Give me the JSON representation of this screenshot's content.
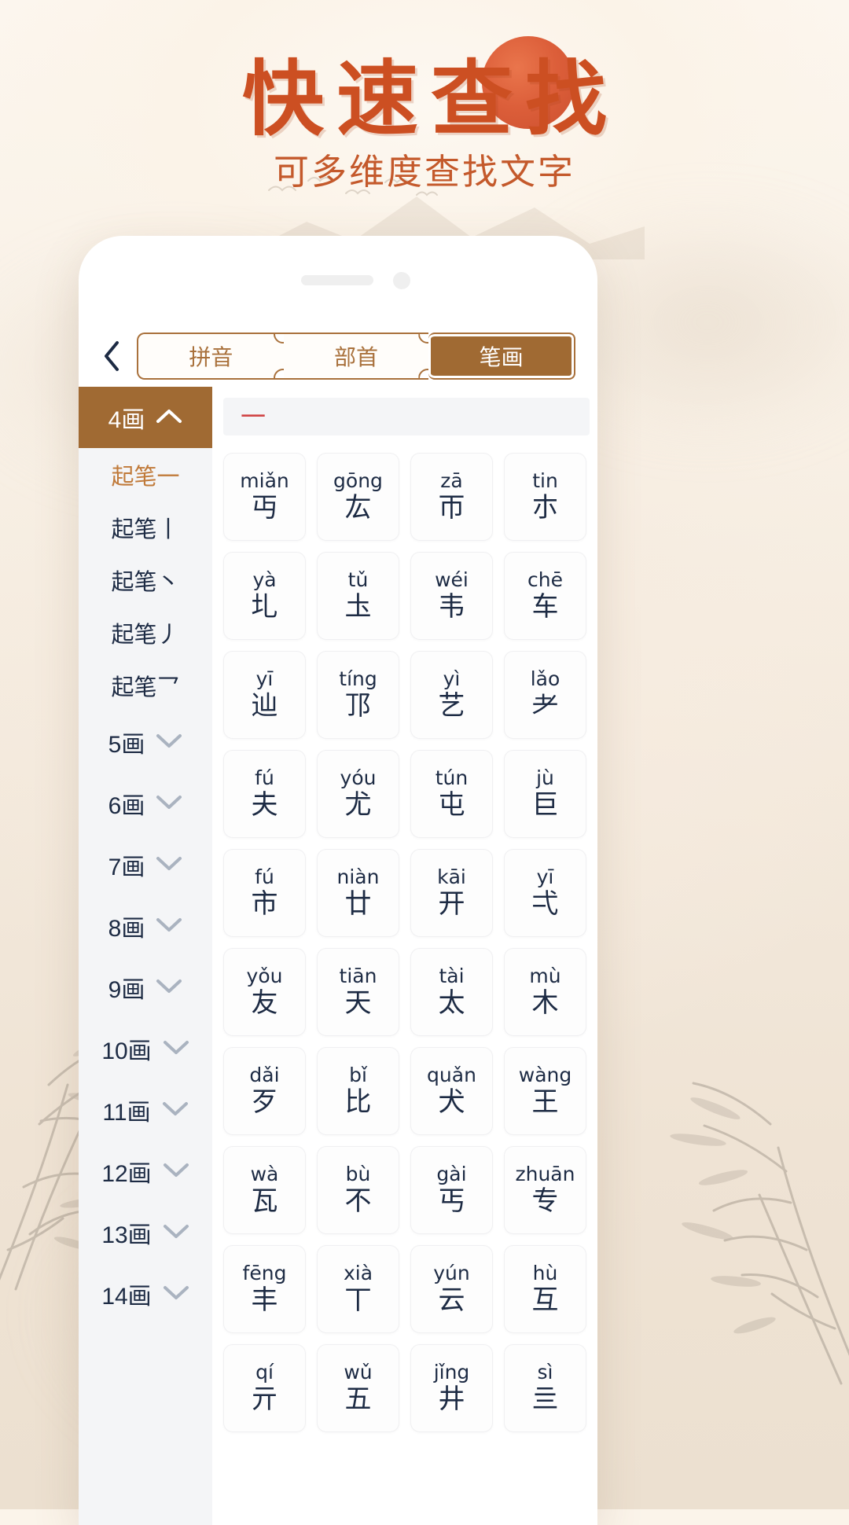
{
  "poster": {
    "headline": "快速查找",
    "subline": "可多维度查找文字",
    "accent_color": "#cc4f22",
    "sun_color": "#d9512a"
  },
  "phone": {
    "nav": {
      "back_icon": "chevron-left-icon",
      "tabs": [
        {
          "label": "拼音",
          "active": false
        },
        {
          "label": "部首",
          "active": false
        },
        {
          "label": "笔画",
          "active": true
        }
      ]
    },
    "sidebar": {
      "groups": [
        {
          "label": "4画",
          "chevron": "∧",
          "expanded": true,
          "active": true,
          "subitems": [
            {
              "label": "起笔一",
              "selected": true
            },
            {
              "label": "起笔丨",
              "selected": false
            },
            {
              "label": "起笔丶",
              "selected": false
            },
            {
              "label": "起笔丿",
              "selected": false
            },
            {
              "label": "起笔乛",
              "selected": false
            }
          ]
        },
        {
          "label": "5画",
          "chevron": "∨",
          "expanded": false,
          "active": false,
          "subitems": []
        },
        {
          "label": "6画",
          "chevron": "∨",
          "expanded": false,
          "active": false,
          "subitems": []
        },
        {
          "label": "7画",
          "chevron": "∨",
          "expanded": false,
          "active": false,
          "subitems": []
        },
        {
          "label": "8画",
          "chevron": "∨",
          "expanded": false,
          "active": false,
          "subitems": []
        },
        {
          "label": "9画",
          "chevron": "∨",
          "expanded": false,
          "active": false,
          "subitems": []
        },
        {
          "label": "10画",
          "chevron": "∨",
          "expanded": false,
          "active": false,
          "subitems": []
        },
        {
          "label": "11画",
          "chevron": "∨",
          "expanded": false,
          "active": false,
          "subitems": []
        },
        {
          "label": "12画",
          "chevron": "∨",
          "expanded": false,
          "active": false,
          "subitems": []
        },
        {
          "label": "13画",
          "chevron": "∨",
          "expanded": false,
          "active": false,
          "subitems": []
        },
        {
          "label": "14画",
          "chevron": "∨",
          "expanded": false,
          "active": false,
          "subitems": []
        }
      ]
    },
    "results": {
      "section_label": "一",
      "section_label_color": "#d04545",
      "columns": 4,
      "characters": [
        {
          "pinyin": "miǎn",
          "char": "丏"
        },
        {
          "pinyin": "gōng",
          "char": "厷"
        },
        {
          "pinyin": "zā",
          "char": "帀"
        },
        {
          "pinyin": "tin",
          "char": "朩"
        },
        {
          "pinyin": "yà",
          "char": "圠"
        },
        {
          "pinyin": "tǔ",
          "char": "圡"
        },
        {
          "pinyin": "wéi",
          "char": "韦"
        },
        {
          "pinyin": "chē",
          "char": "车"
        },
        {
          "pinyin": "yī",
          "char": "辿"
        },
        {
          "pinyin": "tíng",
          "char": "邒"
        },
        {
          "pinyin": "yì",
          "char": "艺"
        },
        {
          "pinyin": "lǎo",
          "char": "耂"
        },
        {
          "pinyin": "fú",
          "char": "夫"
        },
        {
          "pinyin": "yóu",
          "char": "尤"
        },
        {
          "pinyin": "tún",
          "char": "屯"
        },
        {
          "pinyin": "jù",
          "char": "巨"
        },
        {
          "pinyin": "fú",
          "char": "市"
        },
        {
          "pinyin": "niàn",
          "char": "廿"
        },
        {
          "pinyin": "kāi",
          "char": "开"
        },
        {
          "pinyin": "yī",
          "char": "弌"
        },
        {
          "pinyin": "yǒu",
          "char": "友"
        },
        {
          "pinyin": "tiān",
          "char": "天"
        },
        {
          "pinyin": "tài",
          "char": "太"
        },
        {
          "pinyin": "mù",
          "char": "木"
        },
        {
          "pinyin": "dǎi",
          "char": "歹"
        },
        {
          "pinyin": "bǐ",
          "char": "比"
        },
        {
          "pinyin": "quǎn",
          "char": "犬"
        },
        {
          "pinyin": "wàng",
          "char": "王"
        },
        {
          "pinyin": "wà",
          "char": "瓦"
        },
        {
          "pinyin": "bù",
          "char": "不"
        },
        {
          "pinyin": "gài",
          "char": "丐"
        },
        {
          "pinyin": "zhuān",
          "char": "专"
        },
        {
          "pinyin": "fēng",
          "char": "丰"
        },
        {
          "pinyin": "xià",
          "char": "丅"
        },
        {
          "pinyin": "yún",
          "char": "云"
        },
        {
          "pinyin": "hù",
          "char": "互"
        },
        {
          "pinyin": "qí",
          "char": "亓"
        },
        {
          "pinyin": "wǔ",
          "char": "五"
        },
        {
          "pinyin": "jǐng",
          "char": "井"
        },
        {
          "pinyin": "sì",
          "char": "亖"
        }
      ]
    }
  }
}
